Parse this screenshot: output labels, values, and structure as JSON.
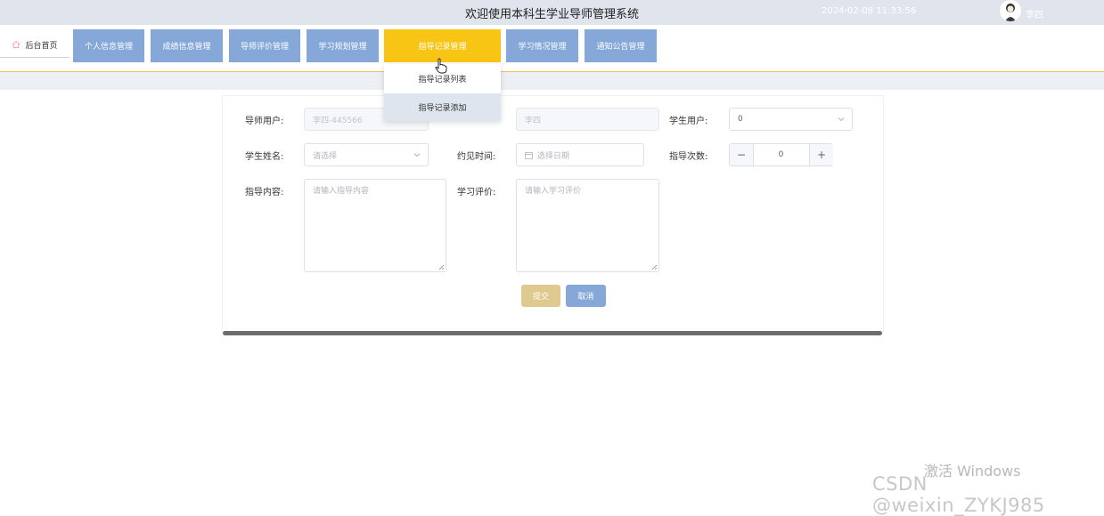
{
  "header": {
    "title": "欢迎使用本科生学业导师管理系统",
    "datetime": "2024-02-08 11:33:56",
    "username": "李四"
  },
  "nav": {
    "home_label": "后台首页",
    "items": [
      {
        "label": "个人信息管理"
      },
      {
        "label": "成绩信息管理"
      },
      {
        "label": "导师评价管理"
      },
      {
        "label": "学习规划管理"
      },
      {
        "label": "指导记录管理",
        "active": true
      },
      {
        "label": "学习情况管理"
      },
      {
        "label": "通知公告管理"
      }
    ]
  },
  "dropdown": {
    "items": [
      {
        "label": "指导记录列表"
      },
      {
        "label": "指导记录添加"
      }
    ]
  },
  "form": {
    "tutor_user_label": "导师用户:",
    "tutor_user_value": "李四-445566",
    "tutor_name_value": "李四",
    "student_user_label": "学生用户:",
    "student_user_value": "0",
    "student_name_label": "学生姓名:",
    "student_name_placeholder": "请选择",
    "appointment_time_label": "约见时间:",
    "appointment_time_placeholder": "选择日期",
    "guide_count_label": "指导次数:",
    "guide_count_value": "0",
    "guide_content_label": "指导内容:",
    "guide_content_placeholder": "请输入指导内容",
    "study_eval_label": "学习评价:",
    "study_eval_placeholder": "请输入学习评价",
    "submit_label": "提交",
    "cancel_label": "取消"
  },
  "watermark": {
    "activate": "激活 Windows",
    "csdn": "CSDN @weixin_ZYKJ985"
  },
  "colors": {
    "nav_button": "#85a8d9",
    "nav_active": "#f9c514",
    "submit": "#e0c98e",
    "cancel": "#85a8d9"
  }
}
